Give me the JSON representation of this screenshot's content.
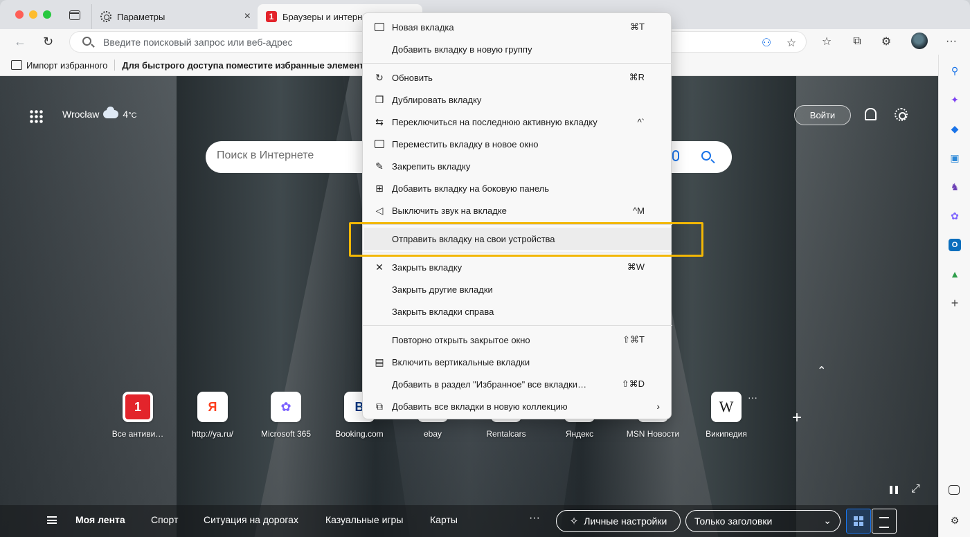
{
  "tabs": {
    "settings_tab": "Параметры",
    "active_tab": "Браузеры и интерн",
    "close_glyph": "×"
  },
  "toolbar": {
    "back": "←",
    "reload": "↻",
    "address_placeholder": "Введите поисковый запрос или веб-адрес",
    "more": "···"
  },
  "favorites_bar": {
    "import_label": "Импорт избранного",
    "hint_label": "Для быстрого доступа поместите избранные элементы н"
  },
  "new_tab_page": {
    "city": "Wrocław",
    "temperature": "4",
    "temperature_unit": "°C",
    "login_label": "Войти",
    "search_placeholder": "Поиск в Интернете",
    "collapse_glyph": "⌃",
    "quick_links": [
      {
        "label": "Все антиви…",
        "tile_text": "1",
        "tile_color": "#e3242b"
      },
      {
        "label": "http://ya.ru/",
        "tile_text": "Я",
        "tile_color": "#fc3f1d"
      },
      {
        "label": "Microsoft 365",
        "tile_text": "✿",
        "tile_color": "#7b61ff"
      },
      {
        "label": "Booking.com",
        "tile_text": "B",
        "tile_color": "#003580"
      },
      {
        "label": "ebay",
        "tile_text": "",
        "tile_color": "#e53238"
      },
      {
        "label": "Rentalcars",
        "tile_text": "",
        "tile_color": "#0a6ebd"
      },
      {
        "label": "Яндекс",
        "tile_text": "",
        "tile_color": "#fc3f1d"
      },
      {
        "label": "MSN Новости",
        "tile_text": "",
        "tile_color": "#222222"
      },
      {
        "label": "Википедия",
        "tile_text": "W",
        "tile_color": "#222222"
      }
    ],
    "quick_links_more": "···",
    "add_link": "+",
    "expand_glyph": "⤢"
  },
  "feed_bar": {
    "items": [
      "Моя лента",
      "Спорт",
      "Ситуация на дорогах",
      "Казуальные игры",
      "Карты"
    ],
    "more": "···",
    "personalize_label": "Личные настройки",
    "layout_value": "Только заголовки",
    "chevron": "⌄"
  },
  "context_menu": {
    "items": [
      {
        "label": "Новая вкладка",
        "shortcut": "⌘T",
        "icon": "new-tab-icon"
      },
      {
        "label": "Добавить вкладку в новую группу",
        "shortcut": "",
        "icon": ""
      },
      {
        "label": "Обновить",
        "shortcut": "⌘R",
        "icon": "refresh-icon"
      },
      {
        "label": "Дублировать вкладку",
        "shortcut": "",
        "icon": "duplicate-icon"
      },
      {
        "label": "Переключиться на последнюю активную вкладку",
        "shortcut": "^`",
        "icon": "switch-tab-icon"
      },
      {
        "label": "Переместить вкладку в новое окно",
        "shortcut": "",
        "icon": "window-icon"
      },
      {
        "label": "Закрепить вкладку",
        "shortcut": "",
        "icon": "pin-icon"
      },
      {
        "label": "Добавить вкладку на боковую панель",
        "shortcut": "",
        "icon": "sidebar-add-icon"
      },
      {
        "label": "Выключить звук на вкладке",
        "shortcut": "^M",
        "icon": "mute-icon"
      },
      {
        "label": "Отправить вкладку на свои устройства",
        "shortcut": "",
        "icon": ""
      },
      {
        "label": "Закрыть вкладку",
        "shortcut": "⌘W",
        "icon": "close-icon"
      },
      {
        "label": "Закрыть другие вкладки",
        "shortcut": "",
        "icon": ""
      },
      {
        "label": "Закрыть вкладки справа",
        "shortcut": "",
        "icon": ""
      },
      {
        "label": "Повторно открыть закрытое окно",
        "shortcut": "⇧⌘T",
        "icon": ""
      },
      {
        "label": "Включить вертикальные вкладки",
        "shortcut": "",
        "icon": "vertical-tabs-icon"
      },
      {
        "label": "Добавить в раздел \"Избранное\" все вкладки…",
        "shortcut": "⇧⌘D",
        "icon": ""
      },
      {
        "label": "Добавить все вкладки в новую коллекцию",
        "shortcut": "",
        "icon": "collection-icon"
      }
    ],
    "submenu_arrow": "›"
  },
  "colors": {
    "highlight_outline": "#f2b705",
    "accent_blue": "#1a73e8"
  },
  "sidebar": {
    "add": "+"
  }
}
